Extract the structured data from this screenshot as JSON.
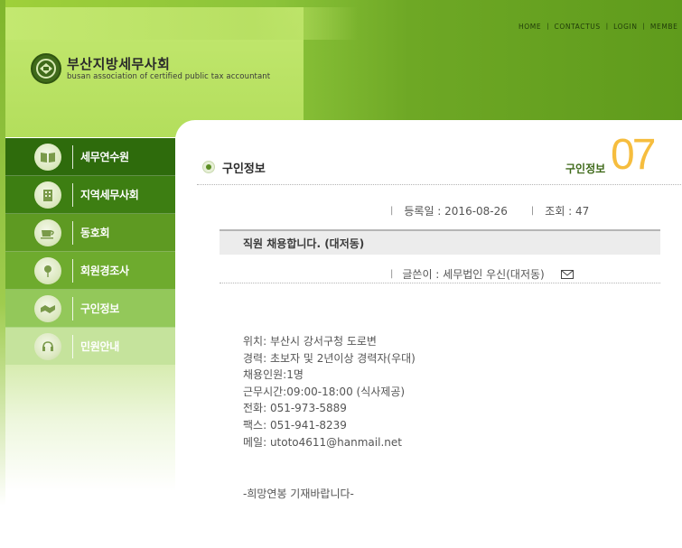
{
  "brand": {
    "title": "부산지방세무사회",
    "subtitle": "busan association of certified public tax accountant"
  },
  "top_links": [
    "HOME",
    "CONTACTUS",
    "LOGIN",
    "MEMBE"
  ],
  "nav": {
    "items": [
      {
        "label": "세무연수원",
        "bg": "#2e6b0c"
      },
      {
        "label": "지역세무사회",
        "bg": "#3d7e12"
      },
      {
        "label": "동호회",
        "bg": "#5e9a22"
      },
      {
        "label": "회원경조사",
        "bg": "#6eab2e"
      },
      {
        "label": "구인정보",
        "bg": "#93c85a"
      },
      {
        "label": "민원안내",
        "bg": "#c5e39c"
      }
    ]
  },
  "page": {
    "heading": "구인정보",
    "section_label": "구인정보",
    "section_number": "07"
  },
  "post": {
    "date_label": "등록일 : 2016-08-26",
    "views_label": "조회 : 47",
    "title": "직원 채용합니다. (대저동)",
    "author_label": "글쓴이 : 세무법인 우신(대저동)",
    "body_lines": [
      "위치: 부산시 강서구청 도로변",
      "경력: 초보자 및 2년이상 경력자(우대)",
      "채용인원:1명",
      "근무시간:09:00-18:00 (식사제공)",
      "전화: 051-973-5889",
      "팩스: 051-941-8239",
      "메일: utoto4611@hanmail.net"
    ],
    "closing": "-희망연봉 기재바랍니다-"
  },
  "colors": {
    "accent_green": "#5f9b1c",
    "badge_orange": "#f6bd3e"
  },
  "icons": {
    "logo": "association-logo-icon",
    "mail": "mail-icon"
  }
}
